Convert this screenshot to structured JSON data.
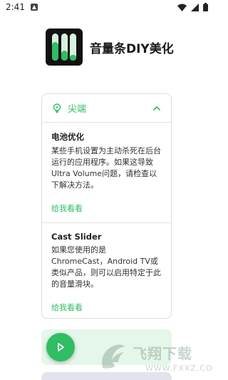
{
  "status_bar": {
    "time": "2:41",
    "icons": [
      "notification-icon",
      "wifi-icon",
      "signal-icon",
      "battery-icon"
    ]
  },
  "app": {
    "title": "音量条DIY美化",
    "icon": "volume-sliders-icon",
    "accent_color": "#2fbe62"
  },
  "tips_card": {
    "header_label": "尖端",
    "header_icon": "lightbulb-icon",
    "expanded": true,
    "sections": [
      {
        "title": "电池优化",
        "body": "某些手机设置为主动杀死在后台运行的应用程序。如果这导致Ultra Volume问题，请检查以下解决方法。",
        "link": "给我看看"
      },
      {
        "title": "Cast Slider",
        "body": "如果您使用的是ChromeCast，Android TV或类似产品，则可以启用特定于此的音量滑块。",
        "link": "给我看看"
      }
    ]
  },
  "fab": {
    "icon": "play-icon"
  },
  "watermark": {
    "text": "飞翔下载",
    "url": "WWW.FXXZ.COM"
  }
}
